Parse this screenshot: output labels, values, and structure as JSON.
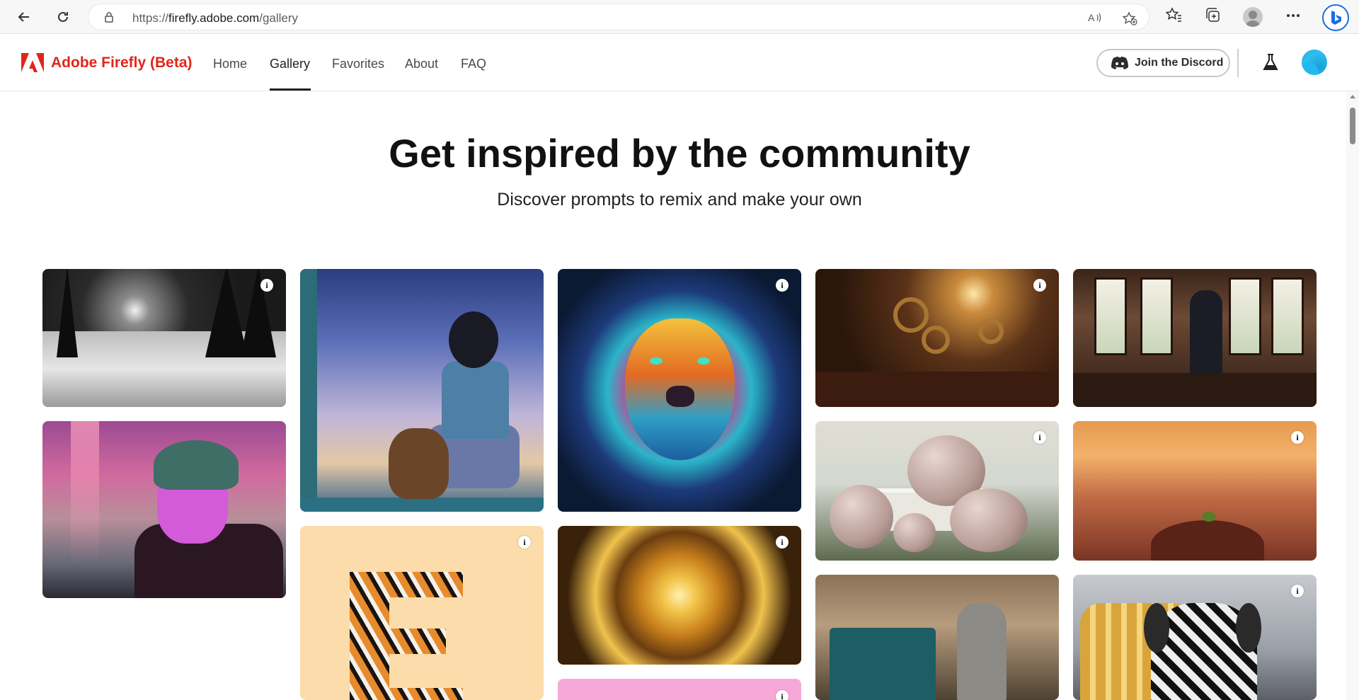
{
  "browser": {
    "url_prefix": "https://",
    "url_host": "firefly.adobe.com",
    "url_path": "/gallery"
  },
  "header": {
    "brand": "Adobe Firefly (Beta)",
    "nav": [
      {
        "label": "Home"
      },
      {
        "label": "Gallery"
      },
      {
        "label": "Favorites"
      },
      {
        "label": "About"
      },
      {
        "label": "FAQ"
      }
    ],
    "active_tab": "Gallery",
    "discord_label": "Join the Discord"
  },
  "hero": {
    "title": "Get inspired by the community",
    "subtitle": "Discover prompts to remix and make your own"
  },
  "gallery": {
    "info_glyph": "i",
    "images": [
      {
        "subject": "snowy forest night"
      },
      {
        "subject": "child and teddy bear watching stars"
      },
      {
        "subject": "colorful psychedelic lion"
      },
      {
        "subject": "steampunk interior"
      },
      {
        "subject": "person at window"
      },
      {
        "subject": "person with neon glasses"
      },
      {
        "subject": "tiger fur letter E"
      },
      {
        "subject": "golden kaleidoscope"
      },
      {
        "subject": "pink image"
      },
      {
        "subject": "fuzzy sphere architecture"
      },
      {
        "subject": "sprout on desert hill"
      },
      {
        "subject": "woman at piano"
      },
      {
        "subject": "zebra with gold crown"
      }
    ]
  },
  "colors": {
    "brand_red": "#e1251b",
    "browser_accent": "#1a6de0"
  }
}
